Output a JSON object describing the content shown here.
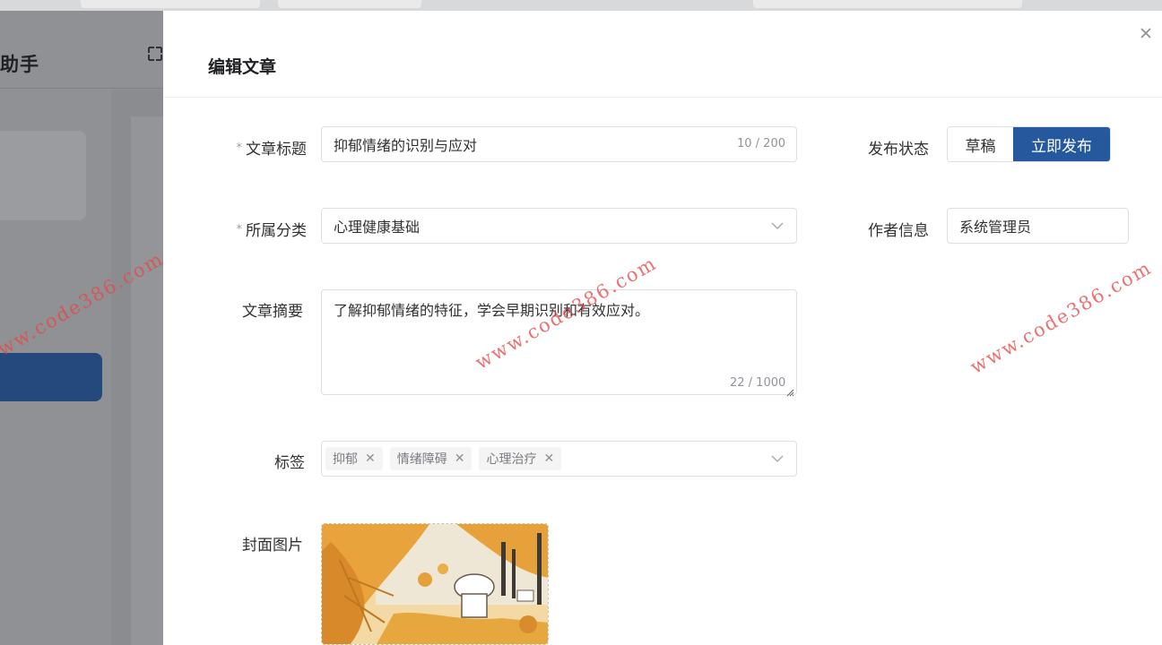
{
  "background_app": {
    "brand_text": "助手",
    "collapse_icon": "expand-icon"
  },
  "drawer": {
    "title": "编辑文章",
    "close_icon": "close-icon"
  },
  "form": {
    "title": {
      "label": "文章标题",
      "required_mark": "*",
      "value": "抑郁情绪的识别与应对",
      "counter": "10 / 200"
    },
    "publish_status": {
      "label": "发布状态",
      "options": [
        "草稿",
        "立即发布"
      ],
      "selected": "立即发布"
    },
    "category": {
      "label": "所属分类",
      "required_mark": "*",
      "value": "心理健康基础"
    },
    "author": {
      "label": "作者信息",
      "value": "系统管理员"
    },
    "summary": {
      "label": "文章摘要",
      "value": "了解抑郁情绪的特征，学会早期识别和有效应对。",
      "counter": "22 / 1000"
    },
    "tags": {
      "label": "标签",
      "items": [
        "抑郁",
        "情绪障碍",
        "心理治疗"
      ]
    },
    "cover": {
      "label": "封面图片"
    }
  },
  "watermark": {
    "text": "www.code386.com"
  },
  "colors": {
    "primary": "#25589c",
    "overlay": "#8f9194",
    "watermark": "#e84848"
  }
}
